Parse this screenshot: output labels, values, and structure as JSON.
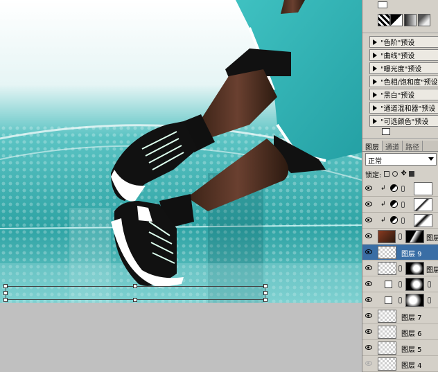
{
  "presets": [
    {
      "label": "\"色阶\"预设"
    },
    {
      "label": "\"曲线\"预设"
    },
    {
      "label": "\"曝光度\"预设"
    },
    {
      "label": "\"色相/饱和度\"预设"
    },
    {
      "label": "\"黑白\"预设"
    },
    {
      "label": "\"通道混和器\"预设"
    },
    {
      "label": "\"可选颜色\"预设"
    }
  ],
  "tabs": [
    "图层",
    "通道",
    "路径"
  ],
  "blend_mode": "正常",
  "lock_label": "锁定:",
  "layers": [
    {
      "name": ""
    },
    {
      "name": ""
    },
    {
      "name": ""
    },
    {
      "name": "图层"
    },
    {
      "name": "图层 9"
    },
    {
      "name": "图层"
    },
    {
      "name": ""
    },
    {
      "name": ""
    },
    {
      "name": "图层 7"
    },
    {
      "name": "图层 6"
    },
    {
      "name": "图层 5"
    },
    {
      "name": "图层 4"
    }
  ],
  "colors": {
    "teal": "#3db8b8",
    "teal_dark": "#1d7f82",
    "selection": "#3a6ea5",
    "panel_bg": "#d4d0c8"
  }
}
